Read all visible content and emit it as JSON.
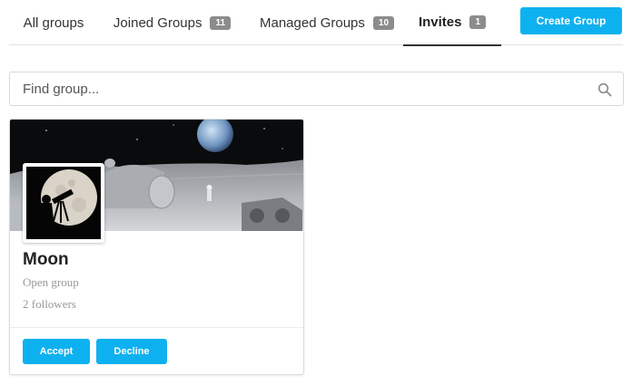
{
  "tabs": [
    {
      "label": "All groups",
      "count": null
    },
    {
      "label": "Joined Groups",
      "count": "11"
    },
    {
      "label": "Managed Groups",
      "count": "10"
    },
    {
      "label": "Invites",
      "count": "1"
    }
  ],
  "active_tab": "Invites",
  "create_button": "Create Group",
  "search": {
    "placeholder": "Find group...",
    "value": "",
    "icon": "search-icon"
  },
  "groups": [
    {
      "name": "Moon",
      "type": "Open group",
      "followers": "2 followers",
      "actions": {
        "accept": "Accept",
        "decline": "Decline"
      }
    }
  ],
  "colors": {
    "accent": "#0eb1ef",
    "badge": "#8c8c8c"
  }
}
